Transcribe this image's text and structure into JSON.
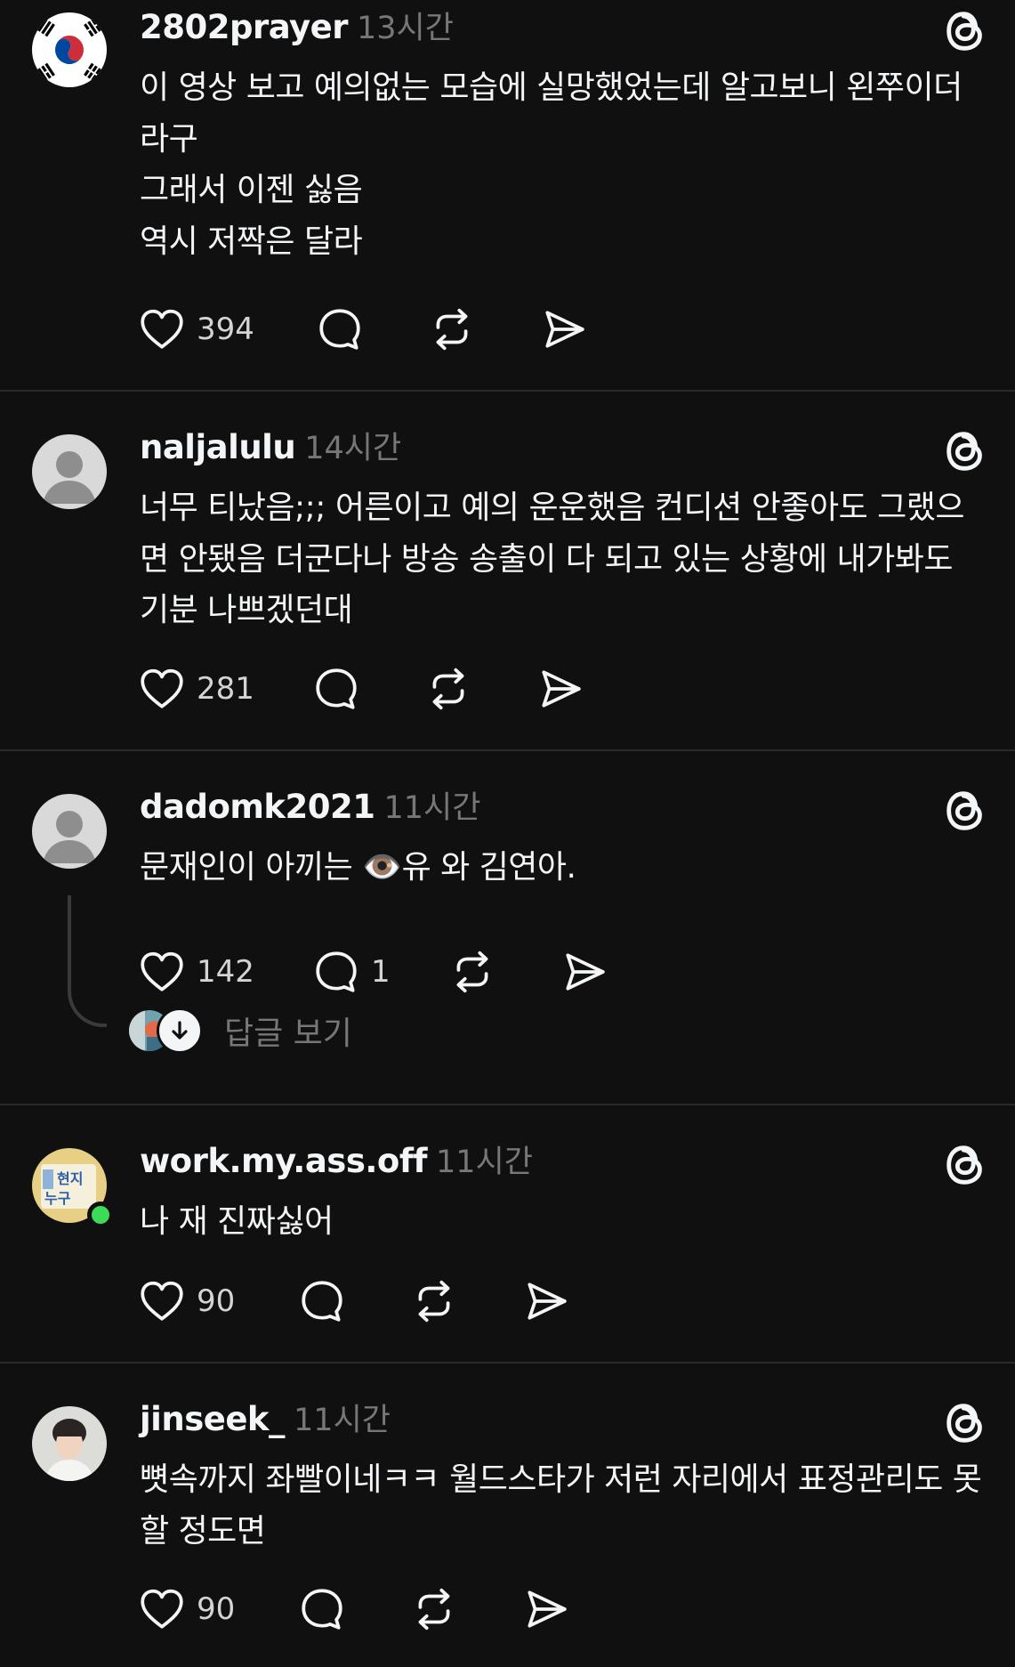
{
  "posts": [
    {
      "username": "2802prayer",
      "time": "13시간",
      "avatar": "korean-flag",
      "text": "이 영상 보고 예의없는 모습에 실망했었는데 알고보니 왼쭈이더\n라구\n그래서 이젠 싫음\n역시 저짝은 달라",
      "likes": "394",
      "comments": ""
    },
    {
      "username": "naljalulu",
      "time": "14시간",
      "avatar": "default-person",
      "text": "너무 티났음;;; 어른이고 예의 운운했음 컨디션 안좋아도 그랬으\n면 안됐음 더군다나 방송 송출이 다 되고 있는 상황에 내가봐도\n기분 나쁘겠던대",
      "likes": "281",
      "comments": ""
    },
    {
      "username": "dadomk2021",
      "time": "11시간",
      "avatar": "default-person",
      "text_before": "문재인이 아끼는 ",
      "emoji": "👁️",
      "text_after": "유 와 김연아.",
      "likes": "142",
      "comments": "1",
      "view_replies_label": "답글 보기"
    },
    {
      "username": "work.my.ass.off",
      "time": "11시간",
      "avatar": "sign-photo",
      "avatar_sign_text": [
        "현지",
        "누구"
      ],
      "text": "나 재 진짜싫어",
      "likes": "90",
      "comments": ""
    },
    {
      "username": "jinseek_",
      "time": "11시간",
      "avatar": "portrait-photo",
      "text": "뼛속까지 좌빨이네ㅋㅋ 월드스타가 저런 자리에서 표정관리도 못\n할 정도면",
      "likes": "90",
      "comments": ""
    }
  ],
  "colors": {
    "background": "#101010",
    "text": "#f3f5f7",
    "muted": "#777777",
    "divider": "#2a2a2a"
  },
  "icons": [
    "heart-icon",
    "comment-icon",
    "repost-icon",
    "share-icon",
    "threads-logo-icon",
    "reply-arrow-icon"
  ]
}
